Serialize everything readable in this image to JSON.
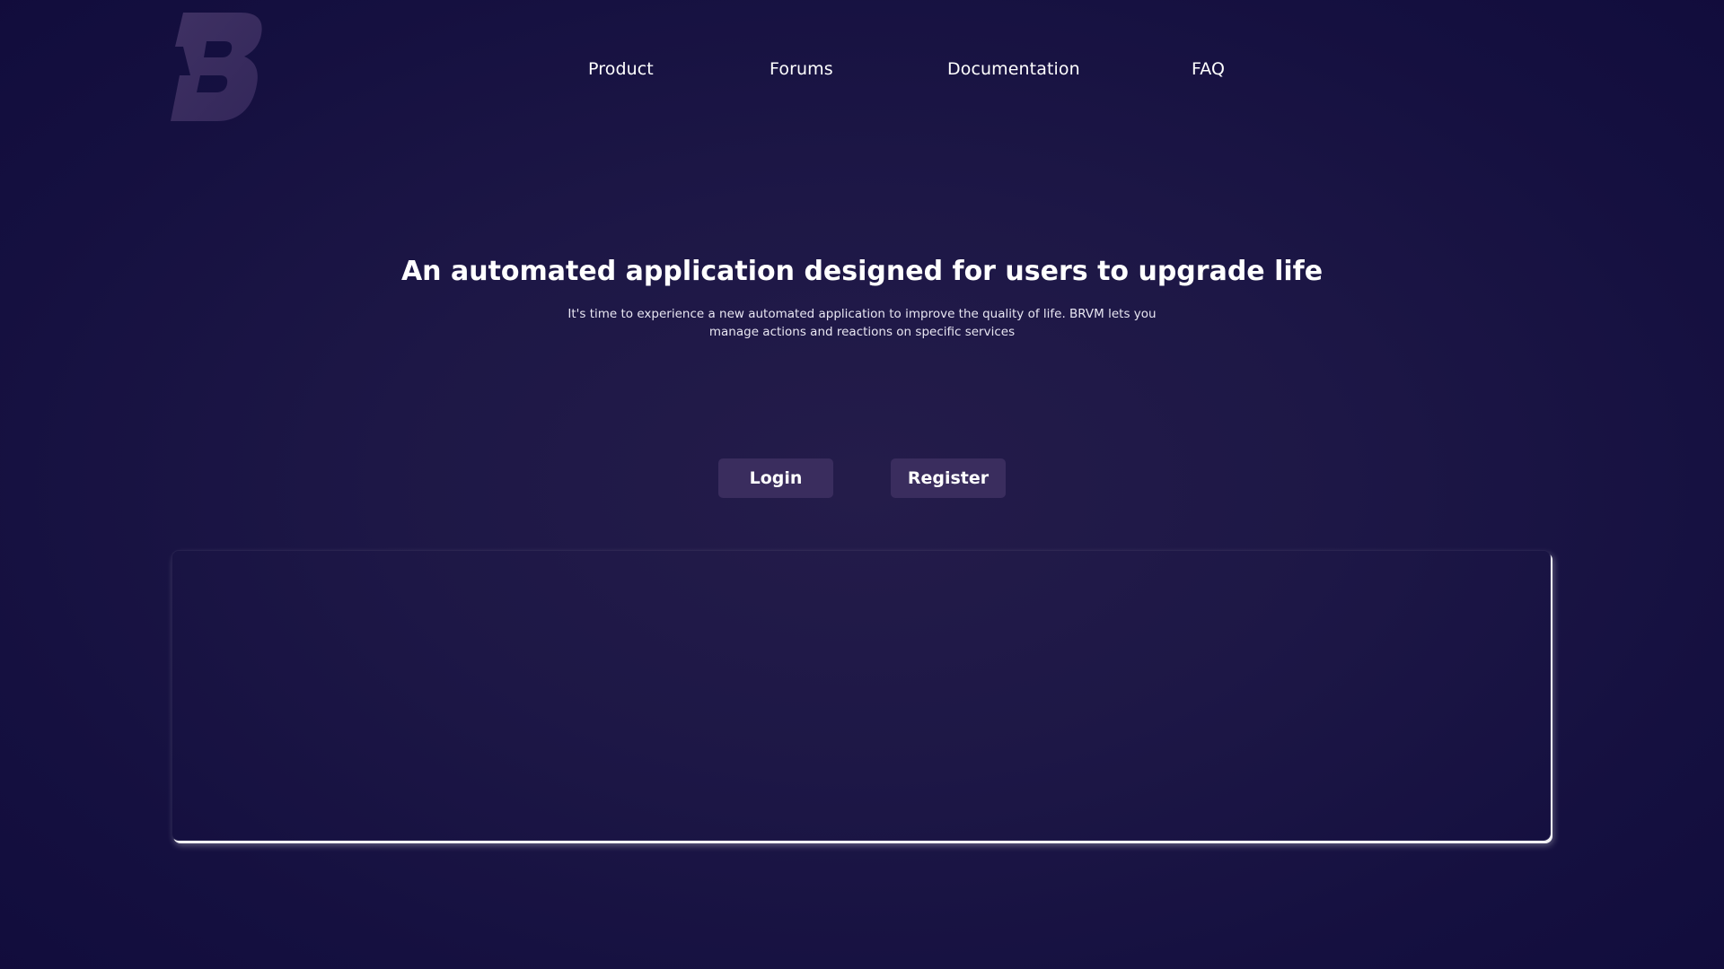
{
  "brand": {
    "logo_icon": "b-letter-logo",
    "logo_color": "#3a2d5e"
  },
  "nav": {
    "items": [
      {
        "label": "Product"
      },
      {
        "label": "Forums"
      },
      {
        "label": "Documentation"
      },
      {
        "label": "FAQ"
      }
    ]
  },
  "hero": {
    "title": "An automated application designed for users to upgrade life",
    "subtitle": "It's time to experience a new automated application to improve the quality of life. BRVM lets you manage actions and reactions on specific services"
  },
  "actions": {
    "login_label": "Login",
    "register_label": "Register"
  },
  "colors": {
    "background_dark": "#110c3c",
    "background_center": "#241c4a",
    "button_bg": "#3a2d5e",
    "text": "#ffffff"
  }
}
